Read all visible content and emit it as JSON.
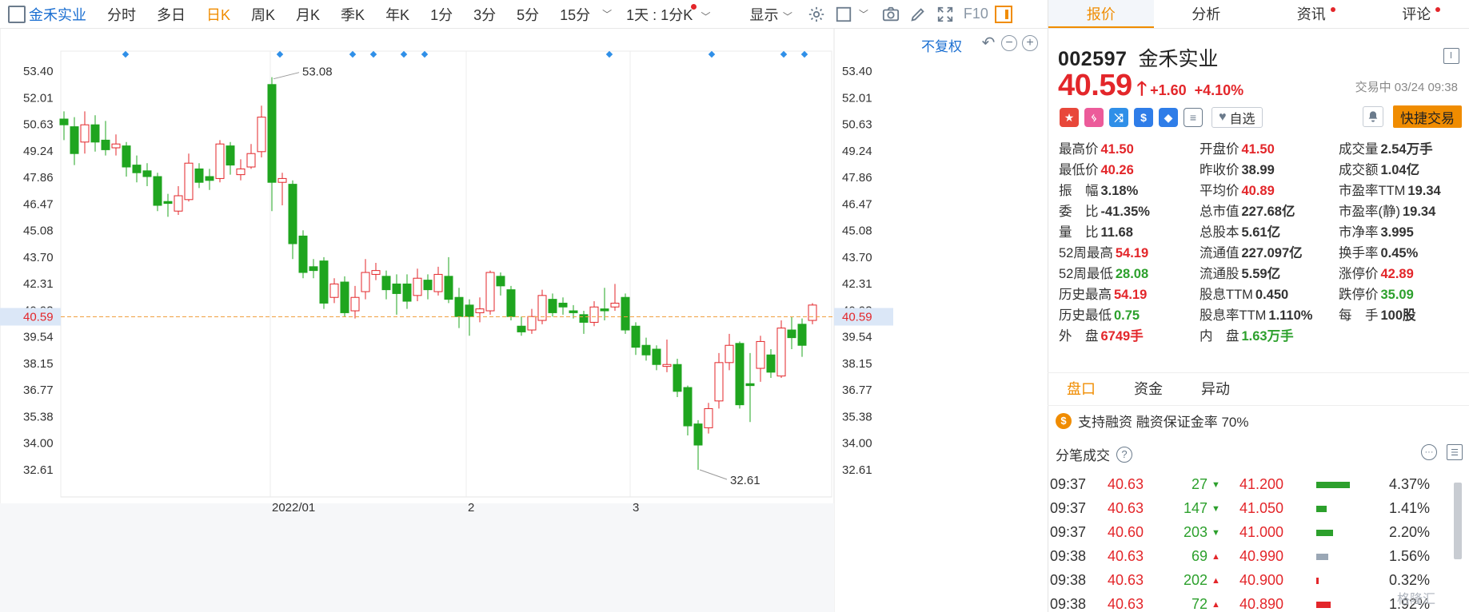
{
  "toolbar": {
    "stock_name": "金禾实业",
    "periods": [
      "分时",
      "多日",
      "日K",
      "周K",
      "月K",
      "季K",
      "年K",
      "1分",
      "3分",
      "5分",
      "15分"
    ],
    "active_period": "日K",
    "multi_period": "1天 : 1分K",
    "display": "显示",
    "f10": "F10"
  },
  "chart": {
    "adjust_btn": "不复权",
    "y_ticks": [
      "53.40",
      "52.01",
      "50.63",
      "49.24",
      "47.86",
      "46.47",
      "45.08",
      "43.70",
      "42.31",
      "40.93",
      "39.54",
      "38.15",
      "36.77",
      "35.38",
      "34.00",
      "32.61"
    ],
    "current_price_tag": "40.59",
    "high_label": "53.08",
    "low_label": "32.61",
    "date_labels": [
      "2022/01",
      "2",
      "3"
    ]
  },
  "chart_data": {
    "type": "candlestick",
    "ylim": [
      31.5,
      54.5
    ],
    "current_price": 40.59,
    "candles": [
      {
        "o": 50.9,
        "c": 50.6,
        "h": 51.3,
        "l": 49.8,
        "up": false
      },
      {
        "o": 50.5,
        "c": 49.1,
        "h": 51.0,
        "l": 48.5,
        "up": false
      },
      {
        "o": 49.7,
        "c": 50.6,
        "h": 51.3,
        "l": 49.1,
        "up": true
      },
      {
        "o": 50.6,
        "c": 49.7,
        "h": 51.1,
        "l": 49.2,
        "up": false
      },
      {
        "o": 49.8,
        "c": 49.3,
        "h": 50.8,
        "l": 49.0,
        "up": false
      },
      {
        "o": 49.4,
        "c": 49.6,
        "h": 50.1,
        "l": 49.0,
        "up": true
      },
      {
        "o": 49.5,
        "c": 48.4,
        "h": 49.7,
        "l": 47.9,
        "up": false
      },
      {
        "o": 48.5,
        "c": 48.1,
        "h": 49.0,
        "l": 47.6,
        "up": false
      },
      {
        "o": 48.2,
        "c": 47.9,
        "h": 48.6,
        "l": 47.4,
        "up": false
      },
      {
        "o": 47.9,
        "c": 46.4,
        "h": 48.1,
        "l": 46.1,
        "up": false
      },
      {
        "o": 46.6,
        "c": 46.5,
        "h": 47.0,
        "l": 45.8,
        "up": false
      },
      {
        "o": 46.1,
        "c": 46.9,
        "h": 47.4,
        "l": 45.9,
        "up": true
      },
      {
        "o": 46.7,
        "c": 48.6,
        "h": 49.1,
        "l": 46.6,
        "up": true
      },
      {
        "o": 48.3,
        "c": 47.6,
        "h": 48.6,
        "l": 47.3,
        "up": false
      },
      {
        "o": 47.9,
        "c": 47.7,
        "h": 48.3,
        "l": 47.2,
        "up": false
      },
      {
        "o": 47.8,
        "c": 49.6,
        "h": 49.8,
        "l": 47.6,
        "up": true
      },
      {
        "o": 49.5,
        "c": 48.5,
        "h": 49.7,
        "l": 48.0,
        "up": false
      },
      {
        "o": 48.0,
        "c": 48.3,
        "h": 48.8,
        "l": 47.7,
        "up": true
      },
      {
        "o": 48.4,
        "c": 49.1,
        "h": 49.6,
        "l": 48.3,
        "up": true
      },
      {
        "o": 49.2,
        "c": 51.0,
        "h": 51.6,
        "l": 48.9,
        "up": true
      },
      {
        "o": 52.7,
        "c": 47.6,
        "h": 53.08,
        "l": 46.1,
        "up": false
      },
      {
        "o": 47.6,
        "c": 47.8,
        "h": 48.1,
        "l": 46.4,
        "up": true
      },
      {
        "o": 47.5,
        "c": 44.4,
        "h": 47.7,
        "l": 43.6,
        "up": false
      },
      {
        "o": 44.8,
        "c": 42.9,
        "h": 45.1,
        "l": 42.6,
        "up": false
      },
      {
        "o": 43.2,
        "c": 43.0,
        "h": 43.6,
        "l": 42.6,
        "up": false
      },
      {
        "o": 43.5,
        "c": 41.3,
        "h": 43.7,
        "l": 41.0,
        "up": false
      },
      {
        "o": 41.6,
        "c": 42.3,
        "h": 42.6,
        "l": 41.3,
        "up": true
      },
      {
        "o": 42.4,
        "c": 40.8,
        "h": 42.7,
        "l": 40.6,
        "up": false
      },
      {
        "o": 40.9,
        "c": 41.6,
        "h": 42.2,
        "l": 40.5,
        "up": true
      },
      {
        "o": 41.9,
        "c": 42.9,
        "h": 43.6,
        "l": 41.5,
        "up": true
      },
      {
        "o": 42.8,
        "c": 43.0,
        "h": 43.4,
        "l": 42.5,
        "up": true
      },
      {
        "o": 42.7,
        "c": 42.0,
        "h": 43.0,
        "l": 41.5,
        "up": false
      },
      {
        "o": 42.3,
        "c": 41.8,
        "h": 42.8,
        "l": 40.7,
        "up": false
      },
      {
        "o": 42.3,
        "c": 41.4,
        "h": 42.8,
        "l": 41.0,
        "up": false
      },
      {
        "o": 41.7,
        "c": 42.6,
        "h": 43.1,
        "l": 41.4,
        "up": true
      },
      {
        "o": 42.5,
        "c": 42.0,
        "h": 42.8,
        "l": 41.5,
        "up": false
      },
      {
        "o": 41.9,
        "c": 42.8,
        "h": 43.2,
        "l": 41.7,
        "up": true
      },
      {
        "o": 42.7,
        "c": 41.5,
        "h": 43.7,
        "l": 41.3,
        "up": false
      },
      {
        "o": 41.6,
        "c": 40.6,
        "h": 42.1,
        "l": 40.0,
        "up": false
      },
      {
        "o": 40.6,
        "c": 41.2,
        "h": 41.5,
        "l": 39.6,
        "up": false
      },
      {
        "o": 40.8,
        "c": 41.0,
        "h": 41.6,
        "l": 40.3,
        "up": true
      },
      {
        "o": 40.9,
        "c": 42.9,
        "h": 43.0,
        "l": 40.7,
        "up": true
      },
      {
        "o": 42.7,
        "c": 42.2,
        "h": 42.9,
        "l": 41.7,
        "up": false
      },
      {
        "o": 42.0,
        "c": 40.6,
        "h": 42.2,
        "l": 40.4,
        "up": false
      },
      {
        "o": 40.1,
        "c": 39.8,
        "h": 40.6,
        "l": 39.6,
        "up": false
      },
      {
        "o": 39.9,
        "c": 40.6,
        "h": 41.0,
        "l": 39.7,
        "up": true
      },
      {
        "o": 40.4,
        "c": 41.7,
        "h": 42.0,
        "l": 40.2,
        "up": true
      },
      {
        "o": 41.5,
        "c": 40.8,
        "h": 41.8,
        "l": 40.6,
        "up": false
      },
      {
        "o": 41.3,
        "c": 41.1,
        "h": 41.6,
        "l": 40.7,
        "up": false
      },
      {
        "o": 40.9,
        "c": 40.8,
        "h": 41.2,
        "l": 40.5,
        "up": false
      },
      {
        "o": 40.7,
        "c": 40.3,
        "h": 40.9,
        "l": 39.7,
        "up": false
      },
      {
        "o": 40.3,
        "c": 41.1,
        "h": 41.4,
        "l": 40.1,
        "up": true
      },
      {
        "o": 41.0,
        "c": 40.9,
        "h": 42.1,
        "l": 40.4,
        "up": false
      },
      {
        "o": 41.1,
        "c": 41.3,
        "h": 42.3,
        "l": 40.9,
        "up": true
      },
      {
        "o": 41.6,
        "c": 39.9,
        "h": 41.8,
        "l": 39.7,
        "up": false
      },
      {
        "o": 40.1,
        "c": 39.0,
        "h": 40.3,
        "l": 38.6,
        "up": false
      },
      {
        "o": 39.1,
        "c": 38.6,
        "h": 39.5,
        "l": 38.3,
        "up": false
      },
      {
        "o": 38.9,
        "c": 38.1,
        "h": 39.1,
        "l": 37.8,
        "up": false
      },
      {
        "o": 38.0,
        "c": 38.1,
        "h": 39.4,
        "l": 37.7,
        "up": true
      },
      {
        "o": 38.1,
        "c": 36.7,
        "h": 38.4,
        "l": 36.4,
        "up": false
      },
      {
        "o": 36.9,
        "c": 34.9,
        "h": 37.0,
        "l": 34.4,
        "up": false
      },
      {
        "o": 35.0,
        "c": 33.9,
        "h": 35.2,
        "l": 32.61,
        "up": false
      },
      {
        "o": 34.8,
        "c": 35.8,
        "h": 36.1,
        "l": 34.5,
        "up": true
      },
      {
        "o": 36.2,
        "c": 38.2,
        "h": 38.7,
        "l": 35.8,
        "up": true
      },
      {
        "o": 38.2,
        "c": 39.1,
        "h": 39.7,
        "l": 37.8,
        "up": true
      },
      {
        "o": 39.2,
        "c": 36.0,
        "h": 39.3,
        "l": 35.8,
        "up": false
      },
      {
        "o": 37.1,
        "c": 37.0,
        "h": 38.7,
        "l": 35.1,
        "up": false
      },
      {
        "o": 37.9,
        "c": 39.3,
        "h": 39.6,
        "l": 37.2,
        "up": true
      },
      {
        "o": 38.6,
        "c": 37.7,
        "h": 38.9,
        "l": 37.4,
        "up": false
      },
      {
        "o": 37.5,
        "c": 40.0,
        "h": 40.4,
        "l": 37.4,
        "up": true
      },
      {
        "o": 39.9,
        "c": 39.5,
        "h": 40.6,
        "l": 38.9,
        "up": false
      },
      {
        "o": 40.2,
        "c": 39.1,
        "h": 40.5,
        "l": 38.5,
        "up": false
      },
      {
        "o": 40.4,
        "c": 41.2,
        "h": 41.3,
        "l": 40.2,
        "up": true
      }
    ]
  },
  "tabs": [
    {
      "label": "报价",
      "active": true,
      "dot": false
    },
    {
      "label": "分析",
      "active": false,
      "dot": false
    },
    {
      "label": "资讯",
      "active": false,
      "dot": true
    },
    {
      "label": "评论",
      "active": false,
      "dot": true
    }
  ],
  "quote": {
    "code": "002597",
    "name": "金禾实业",
    "price": "40.59",
    "change": "+1.60",
    "change_pct": "+4.10%",
    "status": "交易中 03/24 09:38",
    "watch_btn": "自选",
    "quick_trade": "快捷交易"
  },
  "stats": [
    {
      "label": "最高价",
      "value": "41.50",
      "color": "red"
    },
    {
      "label": "开盘价",
      "value": "41.50",
      "color": "red"
    },
    {
      "label": "成交量",
      "value": "2.54万手",
      "color": "dark"
    },
    {
      "label": "最低价",
      "value": "40.26",
      "color": "red"
    },
    {
      "label": "昨收价",
      "value": "38.99",
      "color": "dark"
    },
    {
      "label": "成交额",
      "value": "1.04亿",
      "color": "dark"
    },
    {
      "label": "振　幅",
      "value": "3.18%",
      "color": "dark"
    },
    {
      "label": "平均价",
      "value": "40.89",
      "color": "red"
    },
    {
      "label": "市盈率TTM",
      "value": "19.34",
      "color": "dark"
    },
    {
      "label": "委　比",
      "value": "-41.35%",
      "color": "dark"
    },
    {
      "label": "总市值",
      "value": "227.68亿",
      "color": "dark"
    },
    {
      "label": "市盈率(静)",
      "value": "19.34",
      "color": "dark"
    },
    {
      "label": "量　比",
      "value": "11.68",
      "color": "dark"
    },
    {
      "label": "总股本",
      "value": "5.61亿",
      "color": "dark"
    },
    {
      "label": "市净率",
      "value": "3.995",
      "color": "dark"
    },
    {
      "label": "52周最高",
      "value": "54.19",
      "color": "red"
    },
    {
      "label": "流通值",
      "value": "227.097亿",
      "color": "dark"
    },
    {
      "label": "换手率",
      "value": "0.45%",
      "color": "dark"
    },
    {
      "label": "52周最低",
      "value": "28.08",
      "color": "green"
    },
    {
      "label": "流通股",
      "value": "5.59亿",
      "color": "dark"
    },
    {
      "label": "涨停价",
      "value": "42.89",
      "color": "red"
    },
    {
      "label": "历史最高",
      "value": "54.19",
      "color": "red"
    },
    {
      "label": "股息TTM",
      "value": "0.450",
      "color": "dark"
    },
    {
      "label": "跌停价",
      "value": "35.09",
      "color": "green"
    },
    {
      "label": "历史最低",
      "value": "0.75",
      "color": "green"
    },
    {
      "label": "股息率TTM",
      "value": "1.110%",
      "color": "dark"
    },
    {
      "label": "每　手",
      "value": "100股",
      "color": "dark"
    },
    {
      "label": "外　盘",
      "value": "6749手",
      "color": "red"
    },
    {
      "label": "内　盘",
      "value": "1.63万手",
      "color": "green"
    }
  ],
  "sub_tabs": [
    "盘口",
    "资金",
    "异动"
  ],
  "margin": {
    "coin": "$",
    "text": "支持融资 融资保证金率 70%"
  },
  "ticks_title": "分笔成交",
  "ticks": [
    {
      "time": "09:37",
      "price": "40.63",
      "vol": "27",
      "dir": "down",
      "bprice": "41.200",
      "bar_color": "#2ca02c",
      "bar_pct": 100,
      "pct": "4.37%"
    },
    {
      "time": "09:37",
      "price": "40.63",
      "vol": "147",
      "dir": "down",
      "bprice": "41.050",
      "bar_color": "#2ca02c",
      "bar_pct": 32,
      "pct": "1.41%"
    },
    {
      "time": "09:37",
      "price": "40.60",
      "vol": "203",
      "dir": "down",
      "bprice": "41.000",
      "bar_color": "#2ca02c",
      "bar_pct": 50,
      "pct": "2.20%"
    },
    {
      "time": "09:38",
      "price": "40.63",
      "vol": "69",
      "dir": "up",
      "bprice": "40.990",
      "bar_color": "#9aa7b5",
      "bar_pct": 36,
      "pct": "1.56%"
    },
    {
      "time": "09:38",
      "price": "40.63",
      "vol": "202",
      "dir": "up",
      "bprice": "40.900",
      "bar_color": "#e3262a",
      "bar_pct": 7,
      "pct": "0.32%"
    },
    {
      "time": "09:38",
      "price": "40.63",
      "vol": "72",
      "dir": "up",
      "bprice": "40.890",
      "bar_color": "#e3262a",
      "bar_pct": 44,
      "pct": "1.92%"
    }
  ],
  "colors": {
    "up": "#e3262a",
    "down": "#1fa51f",
    "accent": "#f08c00",
    "link": "#1b6fd1"
  },
  "watermark": "格隆汇"
}
